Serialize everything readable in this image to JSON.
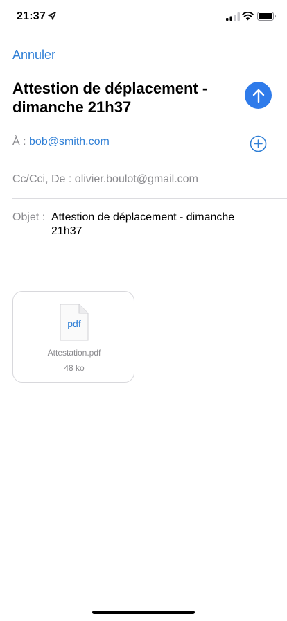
{
  "status_bar": {
    "time": "21:37",
    "icons": [
      "location-arrow-icon",
      "signal-icon",
      "wifi-icon",
      "battery-icon"
    ]
  },
  "nav": {
    "cancel_label": "Annuler"
  },
  "compose": {
    "title": "Attestion de déplacement - dimanche 21h37",
    "send_icon": "arrow-up-icon"
  },
  "fields": {
    "to_label": "À :",
    "to_value": "bob@smith.com",
    "cc_label": "Cc/Cci, De :",
    "cc_value": "olivier.boulot@gmail.com",
    "subject_label": "Objet :",
    "subject_value": "Attestion de déplacement - dimanche 21h37"
  },
  "attachment": {
    "icon_label": "pdf",
    "file_name": "Attestation.pdf",
    "file_size": "48 ko"
  },
  "colors": {
    "accent": "#2f7fd6",
    "send_button": "#2f7bea",
    "secondary_text": "#8a8a8e",
    "divider": "#dcdce0"
  }
}
